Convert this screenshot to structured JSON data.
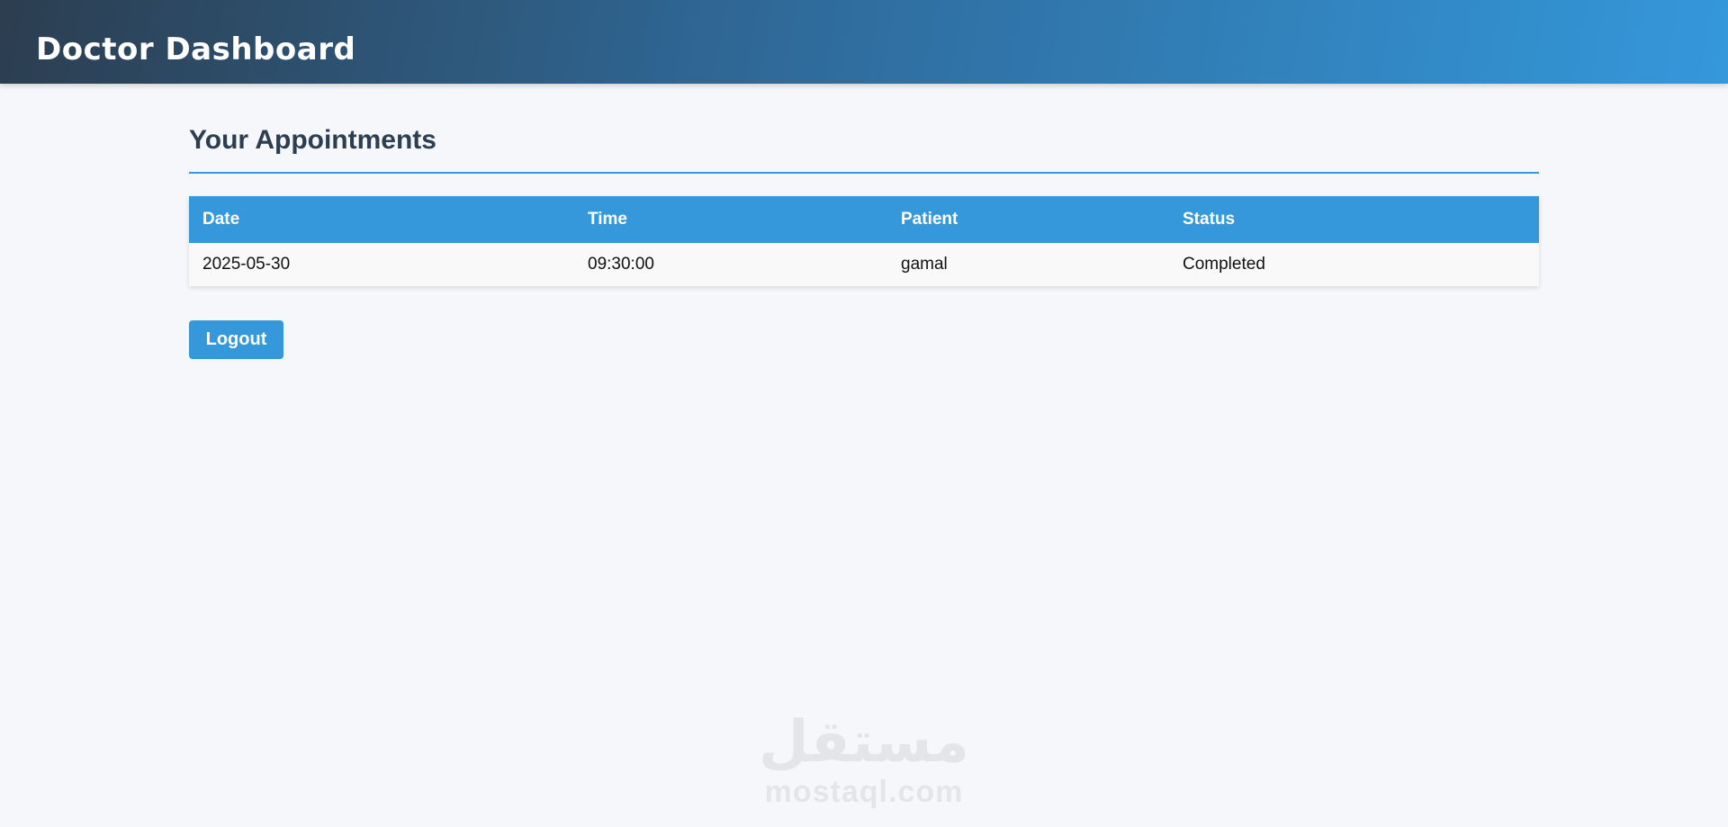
{
  "header": {
    "title": "Doctor Dashboard"
  },
  "main": {
    "section_title": "Your Appointments",
    "table": {
      "columns": [
        "Date",
        "Time",
        "Patient",
        "Status"
      ],
      "rows": [
        [
          "2025-05-30",
          "09:30:00",
          "gamal",
          "Completed"
        ]
      ]
    },
    "logout_label": "Logout"
  },
  "watermark": {
    "arabic": "مستقل",
    "latin": "mostaql.com"
  },
  "colors": {
    "accent": "#3498db",
    "header_dark": "#2c3e50",
    "background": "#f5f7fa"
  }
}
